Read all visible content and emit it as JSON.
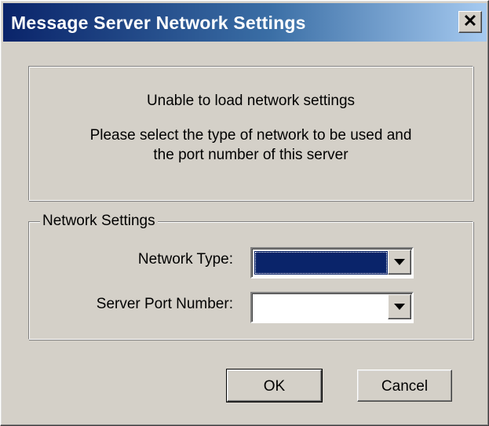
{
  "window": {
    "title": "Message Server Network Settings",
    "close_glyph": "✕"
  },
  "message": {
    "line1": "Unable to load network settings",
    "line2": "Please select the type of network to be used and",
    "line3": "the port number of this server"
  },
  "network_settings": {
    "group_label": "Network Settings",
    "network_type_label": "Network Type:",
    "network_type_value": "",
    "server_port_label": "Server Port Number:",
    "server_port_value": ""
  },
  "buttons": {
    "ok": "OK",
    "cancel": "Cancel"
  },
  "colors": {
    "titlebar_start": "#0a246a",
    "titlebar_end": "#a6caf0",
    "face": "#d4d0c8",
    "selection": "#0a246a"
  }
}
